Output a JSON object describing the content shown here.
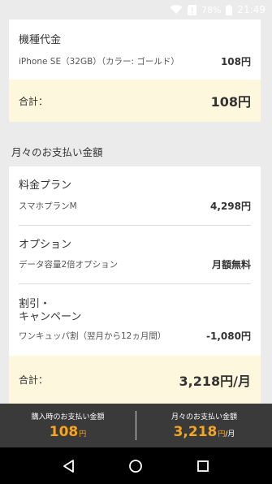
{
  "status_bar": {
    "battery_percent": "78%",
    "time": "21:49",
    "icons": [
      "wifi-icon",
      "sim-alert-icon",
      "battery-icon"
    ]
  },
  "device_card": {
    "title": "機種代金",
    "item_desc": "iPhone SE（32GB）（カラー: ゴールド）",
    "item_price": "108円",
    "total_label": "合計：",
    "total_value": "108円"
  },
  "monthly": {
    "section_title": "月々のお支払い金額",
    "plan_title": "料金プラン",
    "plan_name": "スマホプランM",
    "plan_price": "4,298円",
    "option_title": "オプション",
    "option_name": "データ容量2倍オプション",
    "option_price": "月額無料",
    "discount_title_line1": "割引・",
    "discount_title_line2": "キャンペーン",
    "discount_name": "ワンキュッパ割（翌月から12ヵ月間）",
    "discount_price": "-1,080円",
    "total_label": "合計：",
    "total_value": "3,218円/月"
  },
  "summary_bar": {
    "purchase_label": "購入時のお支払い金額",
    "purchase_amount": "108",
    "purchase_unit": "円",
    "monthly_label": "月々のお支払い金額",
    "monthly_amount": "3,218",
    "monthly_unit": "円",
    "monthly_per": "/月"
  },
  "colors": {
    "background": "#ebebeb",
    "total_bg": "#fdf7dd",
    "summary_bg": "#3a3a3a",
    "accent_orange": "#f7a51c"
  },
  "nav": {
    "icons": [
      "back-icon",
      "home-icon",
      "recents-icon"
    ]
  }
}
